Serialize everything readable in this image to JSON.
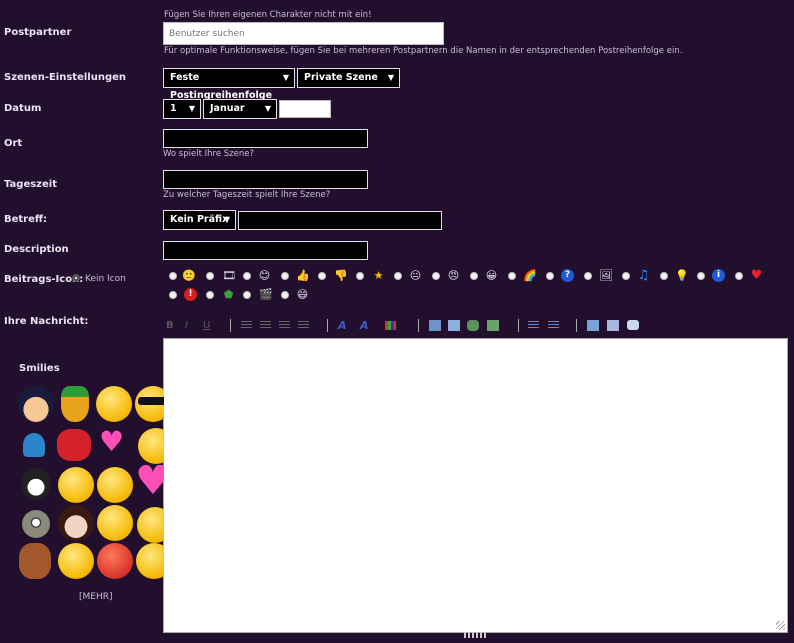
{
  "postpartner": {
    "label": "Postpartner",
    "note_top": "Fügen Sie Ihren eigenen Charakter nicht mit ein!",
    "placeholder": "Benutzer suchen",
    "note_bottom": "Für optimale Funktionsweise, fügen Sie bei mehreren Postpartnern die Namen in der entsprechenden Postreihenfolge ein."
  },
  "scene_settings": {
    "label": "Szenen-Einstellungen",
    "order_value": "Feste Postingreihenfolge",
    "privacy_value": "Private Szene"
  },
  "date": {
    "label": "Datum",
    "day_value": "1",
    "month_value": "Januar",
    "year_value": ""
  },
  "place": {
    "label": "Ort",
    "hint": "Wo spielt Ihre Szene?",
    "value": ""
  },
  "daytime": {
    "label": "Tageszeit",
    "hint": "Zu welcher Tageszeit spielt Ihre Szene?",
    "value": ""
  },
  "subject": {
    "label": "Betreff:",
    "prefix_value": "Kein Präfix",
    "value": ""
  },
  "description": {
    "label": "Description",
    "value": ""
  },
  "post_icon": {
    "label": "Beitrags-Icon:",
    "none_label": "Kein Icon",
    "icons": [
      "smile-icon",
      "film-icon",
      "happy-icon",
      "thumbs-up-icon",
      "thumbs-down-icon",
      "star-icon",
      "neutral-icon",
      "angry-icon",
      "grin-icon",
      "rainbow-icon",
      "question-icon",
      "photo-icon",
      "music-icon",
      "lightbulb-icon",
      "info-icon",
      "heart-icon",
      "exclamation-icon",
      "shield-icon",
      "clapper-icon",
      "laugh-icon"
    ]
  },
  "message": {
    "label": "Ihre Nachricht:",
    "value": ""
  },
  "smilies": {
    "title": "Smilies",
    "more_label": "[MEHR]"
  },
  "colors": {
    "background": "#220f2e",
    "field_bg": "#000000",
    "editor_bg": "#ffffff"
  }
}
